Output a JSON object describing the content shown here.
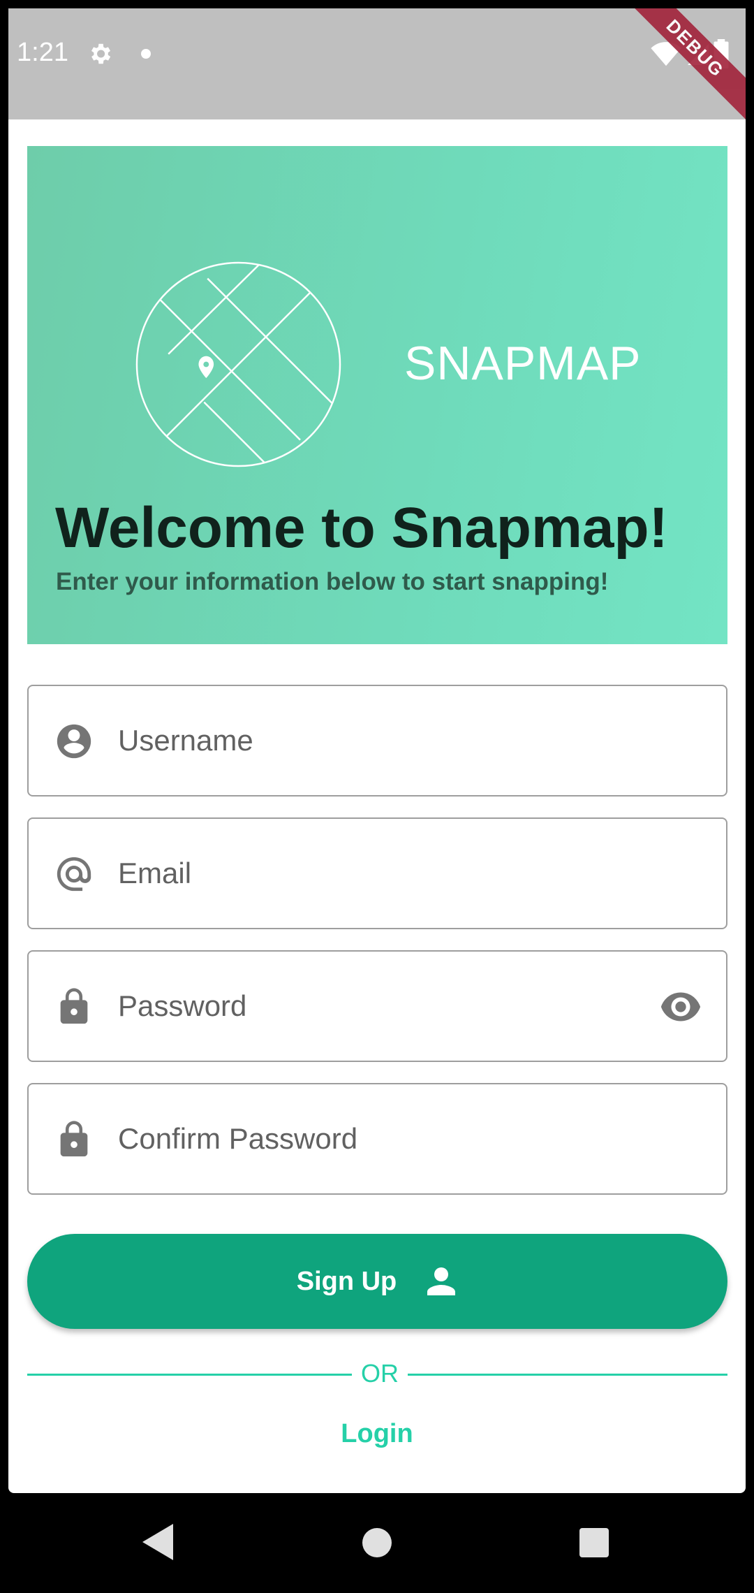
{
  "status_bar": {
    "time": "1:21",
    "debug_label": "DEBUG"
  },
  "hero": {
    "logo_text": "SNAPMAP",
    "title": "Welcome to Snapmap!",
    "subtitle": "Enter your information below to start snapping!"
  },
  "form": {
    "username": {
      "placeholder": "Username",
      "value": "",
      "icon": "account-circle-icon"
    },
    "email": {
      "placeholder": "Email",
      "value": "",
      "icon": "at-sign-icon"
    },
    "password": {
      "placeholder": "Password",
      "value": "",
      "icon": "lock-icon",
      "toggle_icon": "eye-icon"
    },
    "confirm_password": {
      "placeholder": "Confirm Password",
      "value": "",
      "icon": "lock-icon"
    }
  },
  "actions": {
    "signup_label": "Sign Up",
    "or_label": "OR",
    "login_label": "Login"
  },
  "colors": {
    "primary": "#0fa47d",
    "accent": "#25d0a8",
    "hero_gradient_start": "#6ecdaa",
    "hero_gradient_end": "#73e4c4"
  }
}
